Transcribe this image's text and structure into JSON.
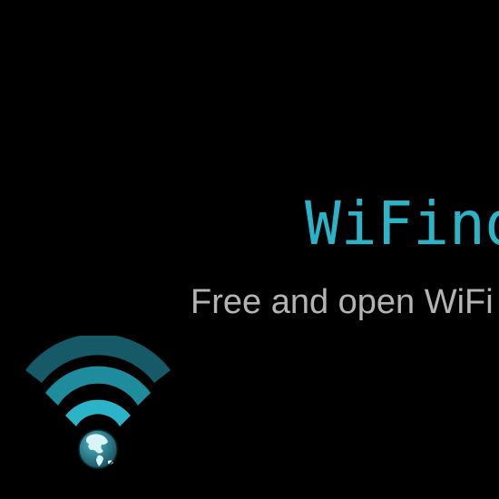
{
  "app": {
    "title": "WiFinder",
    "tagline": "Free and open WiFi"
  },
  "logo": {
    "icon": "wifi-globe-icon"
  },
  "colors": {
    "background": "#000000",
    "accent": "#2bb3c8",
    "arc_outer": "#155a66",
    "arc_middle": "#1f8c9e",
    "arc_inner": "#2bb3c8",
    "tagline": "#b4b4b4",
    "globe_ocean": "#2a7f90",
    "globe_land": "#d9f3f7"
  }
}
